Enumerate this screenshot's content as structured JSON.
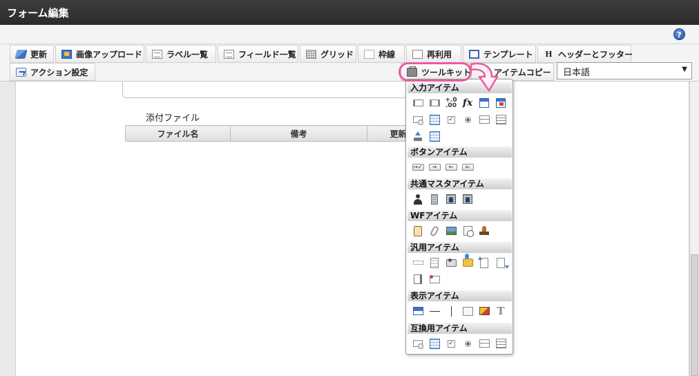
{
  "window": {
    "title": "フォーム編集"
  },
  "toolbar": {
    "row1": [
      {
        "id": "update",
        "label": "更新",
        "icon": "refresh-icon"
      },
      {
        "id": "image-upload",
        "label": "画像アップロード",
        "icon": "image-upload-icon"
      },
      {
        "id": "label-list",
        "label": "ラベル一覧",
        "icon": "list-icon"
      },
      {
        "id": "field-list",
        "label": "フィールド一覧",
        "icon": "list-icon"
      },
      {
        "id": "grid",
        "label": "グリッド",
        "icon": "grid-icon"
      },
      {
        "id": "frame",
        "label": "枠線",
        "icon": "frame-icon"
      },
      {
        "id": "reuse",
        "label": "再利用",
        "icon": "document-icon"
      },
      {
        "id": "template",
        "label": "テンプレート",
        "icon": "template-icon"
      },
      {
        "id": "header-footer",
        "label": "ヘッダーとフッター",
        "icon": "h-icon"
      }
    ],
    "row2": [
      {
        "id": "action-settings",
        "label": "アクション設定",
        "icon": "action-icon"
      },
      {
        "id": "toolkit",
        "label": "ツールキット",
        "icon": "toolkit-icon"
      },
      {
        "id": "item-copy",
        "label": "アイテムコピー",
        "icon": "copy-icon"
      }
    ],
    "language": {
      "selected": "日本語"
    }
  },
  "form": {
    "attachment_label": "添付ファイル",
    "table_headers": [
      "ファイル名",
      "備考",
      "更新"
    ]
  },
  "toolkit_panel": {
    "sections": [
      {
        "title": "入力アイテム",
        "rows": [
          [
            "text-field-icon",
            "text-field-button-icon",
            "number-icon",
            "formula-icon",
            "date-icon",
            "datetime-icon"
          ],
          [
            "select-icon",
            "table-icon",
            "checkbox-icon",
            "radio-icon",
            "list-icon",
            "multi-list-icon"
          ],
          [
            "file-upload-icon",
            "grid-table-icon"
          ]
        ]
      },
      {
        "title": "ボタンアイテム",
        "rows": [
          [
            "submit-button-icon",
            "next-button-icon",
            "back-button-icon",
            "return-button-icon"
          ]
        ]
      },
      {
        "title": "共通マスタアイテム",
        "rows": [
          [
            "user-icon",
            "organization-icon",
            "org-user-icon",
            "org-group-icon"
          ]
        ]
      },
      {
        "title": "WFアイテム",
        "rows": [
          [
            "clipboard-icon",
            "paperclip-icon",
            "image-icon",
            "history-icon",
            "stamp-icon"
          ]
        ]
      },
      {
        "title": "汎用アイテム",
        "rows": [
          [
            "dotted-field-icon",
            "document-lines-icon",
            "camera-icon",
            "folder-link-icon",
            "document-upload-icon",
            "document-download-icon"
          ],
          [
            "bookmark-icon",
            "card-icon"
          ]
        ]
      },
      {
        "title": "表示アイテム",
        "rows": [
          [
            "label-box-icon",
            "horizontal-line-icon",
            "vertical-line-icon",
            "blank-box-icon",
            "picture-icon",
            "text-icon"
          ]
        ]
      },
      {
        "title": "互換用アイテム",
        "rows": [
          [
            "select-icon",
            "table-icon",
            "checkbox-icon",
            "radio-icon",
            "list-icon",
            "multi-list-icon"
          ]
        ]
      }
    ]
  },
  "colors": {
    "titlebar": "#333333",
    "highlight": "#ec5aa0",
    "accent_blue": "#3d72c8"
  }
}
